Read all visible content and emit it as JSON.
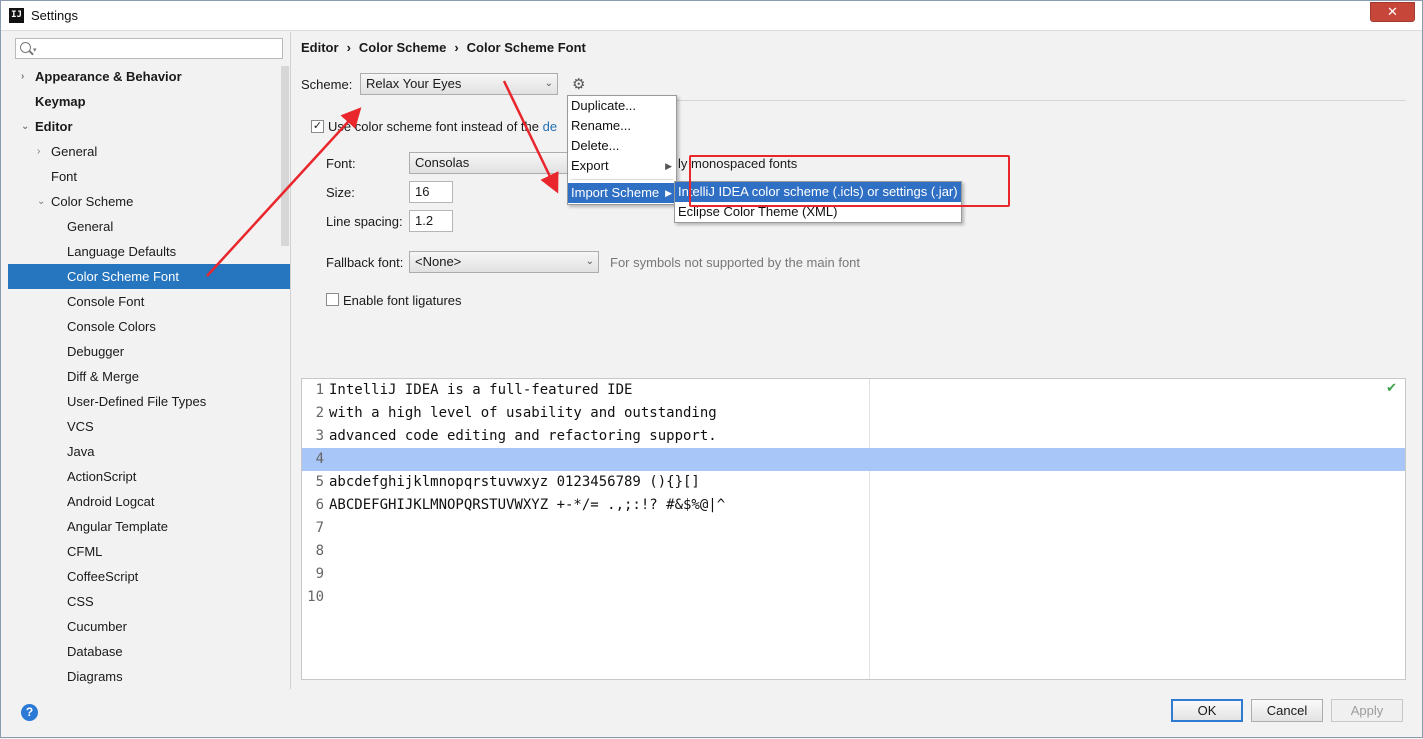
{
  "window": {
    "title": "Settings",
    "app_icon": "IJ",
    "close_label": "✕"
  },
  "sidebar": {
    "search_placeholder": "",
    "items": [
      {
        "label": "Appearance & Behavior",
        "bold": true,
        "arrow": "›"
      },
      {
        "label": "Keymap",
        "bold": true
      },
      {
        "label": "Editor",
        "bold": true,
        "arrow": "⌄"
      },
      {
        "label": "General",
        "arrow": "›"
      },
      {
        "label": "Font"
      },
      {
        "label": "Color Scheme",
        "arrow": "⌄"
      },
      {
        "label": "General"
      },
      {
        "label": "Language Defaults"
      },
      {
        "label": "Color Scheme Font",
        "selected": true
      },
      {
        "label": "Console Font"
      },
      {
        "label": "Console Colors"
      },
      {
        "label": "Debugger"
      },
      {
        "label": "Diff & Merge"
      },
      {
        "label": "User-Defined File Types"
      },
      {
        "label": "VCS"
      },
      {
        "label": "Java"
      },
      {
        "label": "ActionScript"
      },
      {
        "label": "Android Logcat"
      },
      {
        "label": "Angular Template"
      },
      {
        "label": "CFML"
      },
      {
        "label": "CoffeeScript"
      },
      {
        "label": "CSS"
      },
      {
        "label": "Cucumber"
      },
      {
        "label": "Database"
      },
      {
        "label": "Diagrams"
      }
    ]
  },
  "breadcrumb": [
    "Editor",
    "Color Scheme",
    "Color Scheme Font"
  ],
  "breadcrumb_sep": "›",
  "scheme": {
    "label": "Scheme:",
    "value": "Relax Your Eyes",
    "gear_icon": "⚙"
  },
  "use_scheme_font": {
    "checked": true,
    "check": "✓",
    "prefix": "Use color scheme font instead of the",
    "link": "de"
  },
  "font": {
    "label": "Font:",
    "value": "Consolas",
    "only_mono_text": "ly monospaced fonts"
  },
  "size": {
    "label": "Size:",
    "value": "16"
  },
  "line_spacing": {
    "label": "Line spacing:",
    "value": "1.2"
  },
  "fallback": {
    "label": "Fallback font:",
    "value": "<None>",
    "hint": "For symbols not supported by the main font"
  },
  "ligatures": {
    "label": "Enable font ligatures",
    "checked": false
  },
  "gear_menu": {
    "items": [
      "Duplicate...",
      "Rename...",
      "Delete...",
      "Export",
      "Import Scheme"
    ],
    "submenu_arrow": "▶"
  },
  "import_submenu": {
    "items": [
      "IntelliJ IDEA color scheme (.icls) or settings (.jar)",
      "Eclipse Color Theme (XML)"
    ]
  },
  "preview": {
    "lines": [
      {
        "n": "1",
        "text": "IntelliJ IDEA is a full-featured IDE"
      },
      {
        "n": "2",
        "text": "with a high level of usability and outstanding"
      },
      {
        "n": "3",
        "text": "advanced code editing and refactoring support."
      },
      {
        "n": "4",
        "text": ""
      },
      {
        "n": "5",
        "text": "abcdefghijklmnopqrstuvwxyz 0123456789 (){}[]"
      },
      {
        "n": "6",
        "text": "ABCDEFGHIJKLMNOPQRSTUVWXYZ +-*/= .,;:!? #&$%@|^"
      },
      {
        "n": "7",
        "text": ""
      },
      {
        "n": "8",
        "text": ""
      },
      {
        "n": "9",
        "text": ""
      },
      {
        "n": "10",
        "text": ""
      }
    ],
    "current_line": 4,
    "status_icon": "✔"
  },
  "buttons": {
    "ok": "OK",
    "cancel": "Cancel",
    "apply": "Apply"
  },
  "help_icon": "?",
  "colors": {
    "selection": "#2675bf",
    "menu_active": "#2f6fc4",
    "current_line": "#a8c6f7",
    "annotation_red": "#e8262c"
  }
}
